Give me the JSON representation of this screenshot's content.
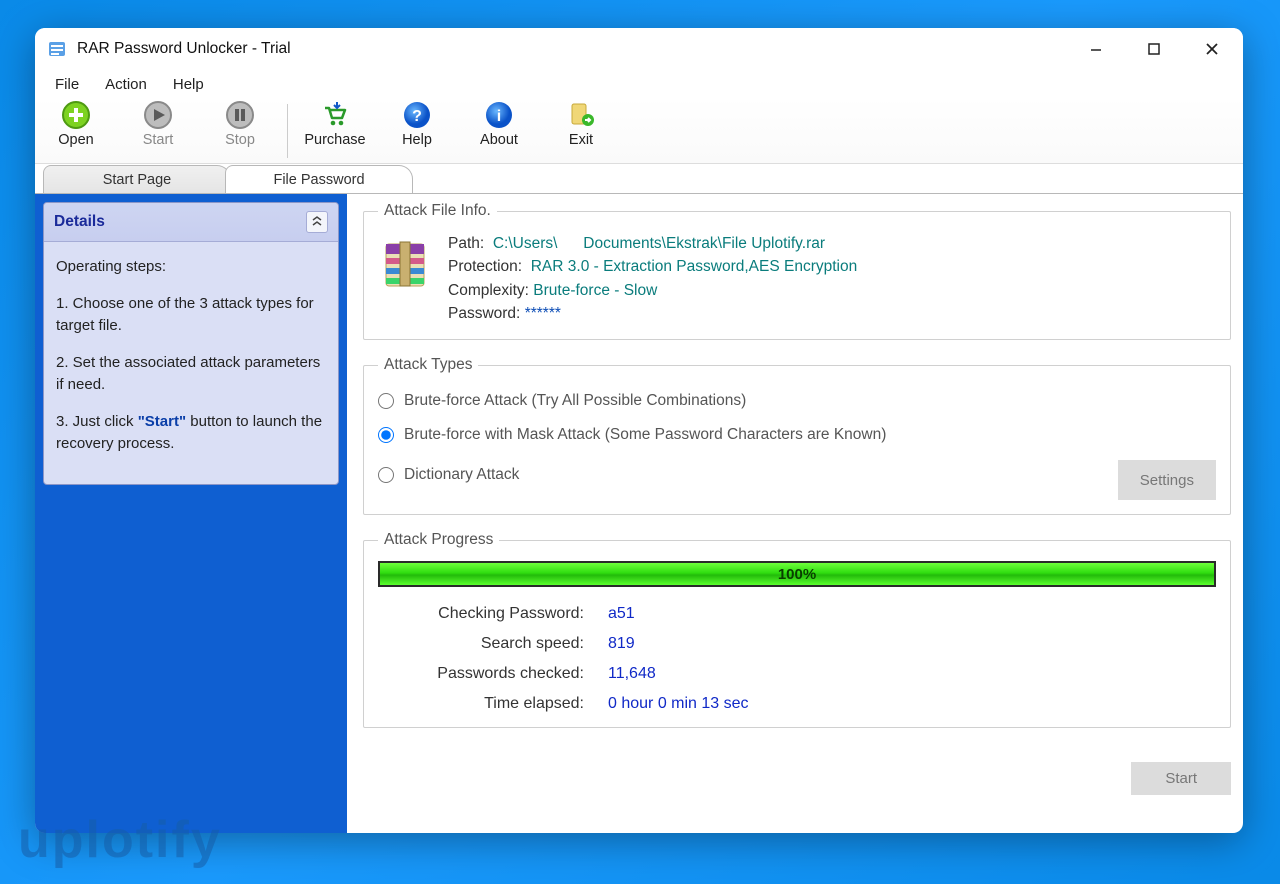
{
  "window": {
    "title": "RAR Password Unlocker - Trial"
  },
  "menu": {
    "file": "File",
    "action": "Action",
    "help": "Help"
  },
  "toolbar": {
    "open": "Open",
    "start": "Start",
    "stop": "Stop",
    "purchase": "Purchase",
    "help": "Help",
    "about": "About",
    "exit": "Exit"
  },
  "tabs": {
    "start_page": "Start Page",
    "file_password": "File Password"
  },
  "sidebar": {
    "panel_title": "Details",
    "steps_heading": "Operating steps:",
    "step1": "1. Choose one of the 3 attack types for target file.",
    "step2": "2. Set the associated attack parameters if need.",
    "step3_a": "3. Just click  ",
    "step3_b": "\"Start\"",
    "step3_c": " button to launch the recovery process."
  },
  "file_info": {
    "legend": "Attack File Info.",
    "path_label": "Path:",
    "path_value_1": "C:\\Users\\",
    "path_value_2": "Documents\\Ekstrak\\File Uplotify.rar",
    "protection_label": "Protection:",
    "protection_value": "RAR 3.0 - Extraction Password,AES Encryption",
    "complexity_label": "Complexity:",
    "complexity_value": "Brute-force - Slow",
    "password_label": "Password:",
    "password_value": "******"
  },
  "attack_types": {
    "legend": "Attack Types",
    "opt1": "Brute-force Attack (Try All Possible Combinations)",
    "opt2": "Brute-force with Mask Attack (Some Password Characters are Known)",
    "opt3": "Dictionary Attack",
    "settings_btn": "Settings"
  },
  "progress": {
    "legend": "Attack Progress",
    "percent": "100%",
    "checking_label": "Checking Password:",
    "checking_value": "a51",
    "speed_label": "Search speed:",
    "speed_value": "819",
    "checked_label": "Passwords checked:",
    "checked_value": "11,648",
    "elapsed_label": "Time elapsed:",
    "elapsed_value": "0 hour 0 min 13 sec"
  },
  "buttons": {
    "start": "Start"
  },
  "watermark": "uplotify"
}
